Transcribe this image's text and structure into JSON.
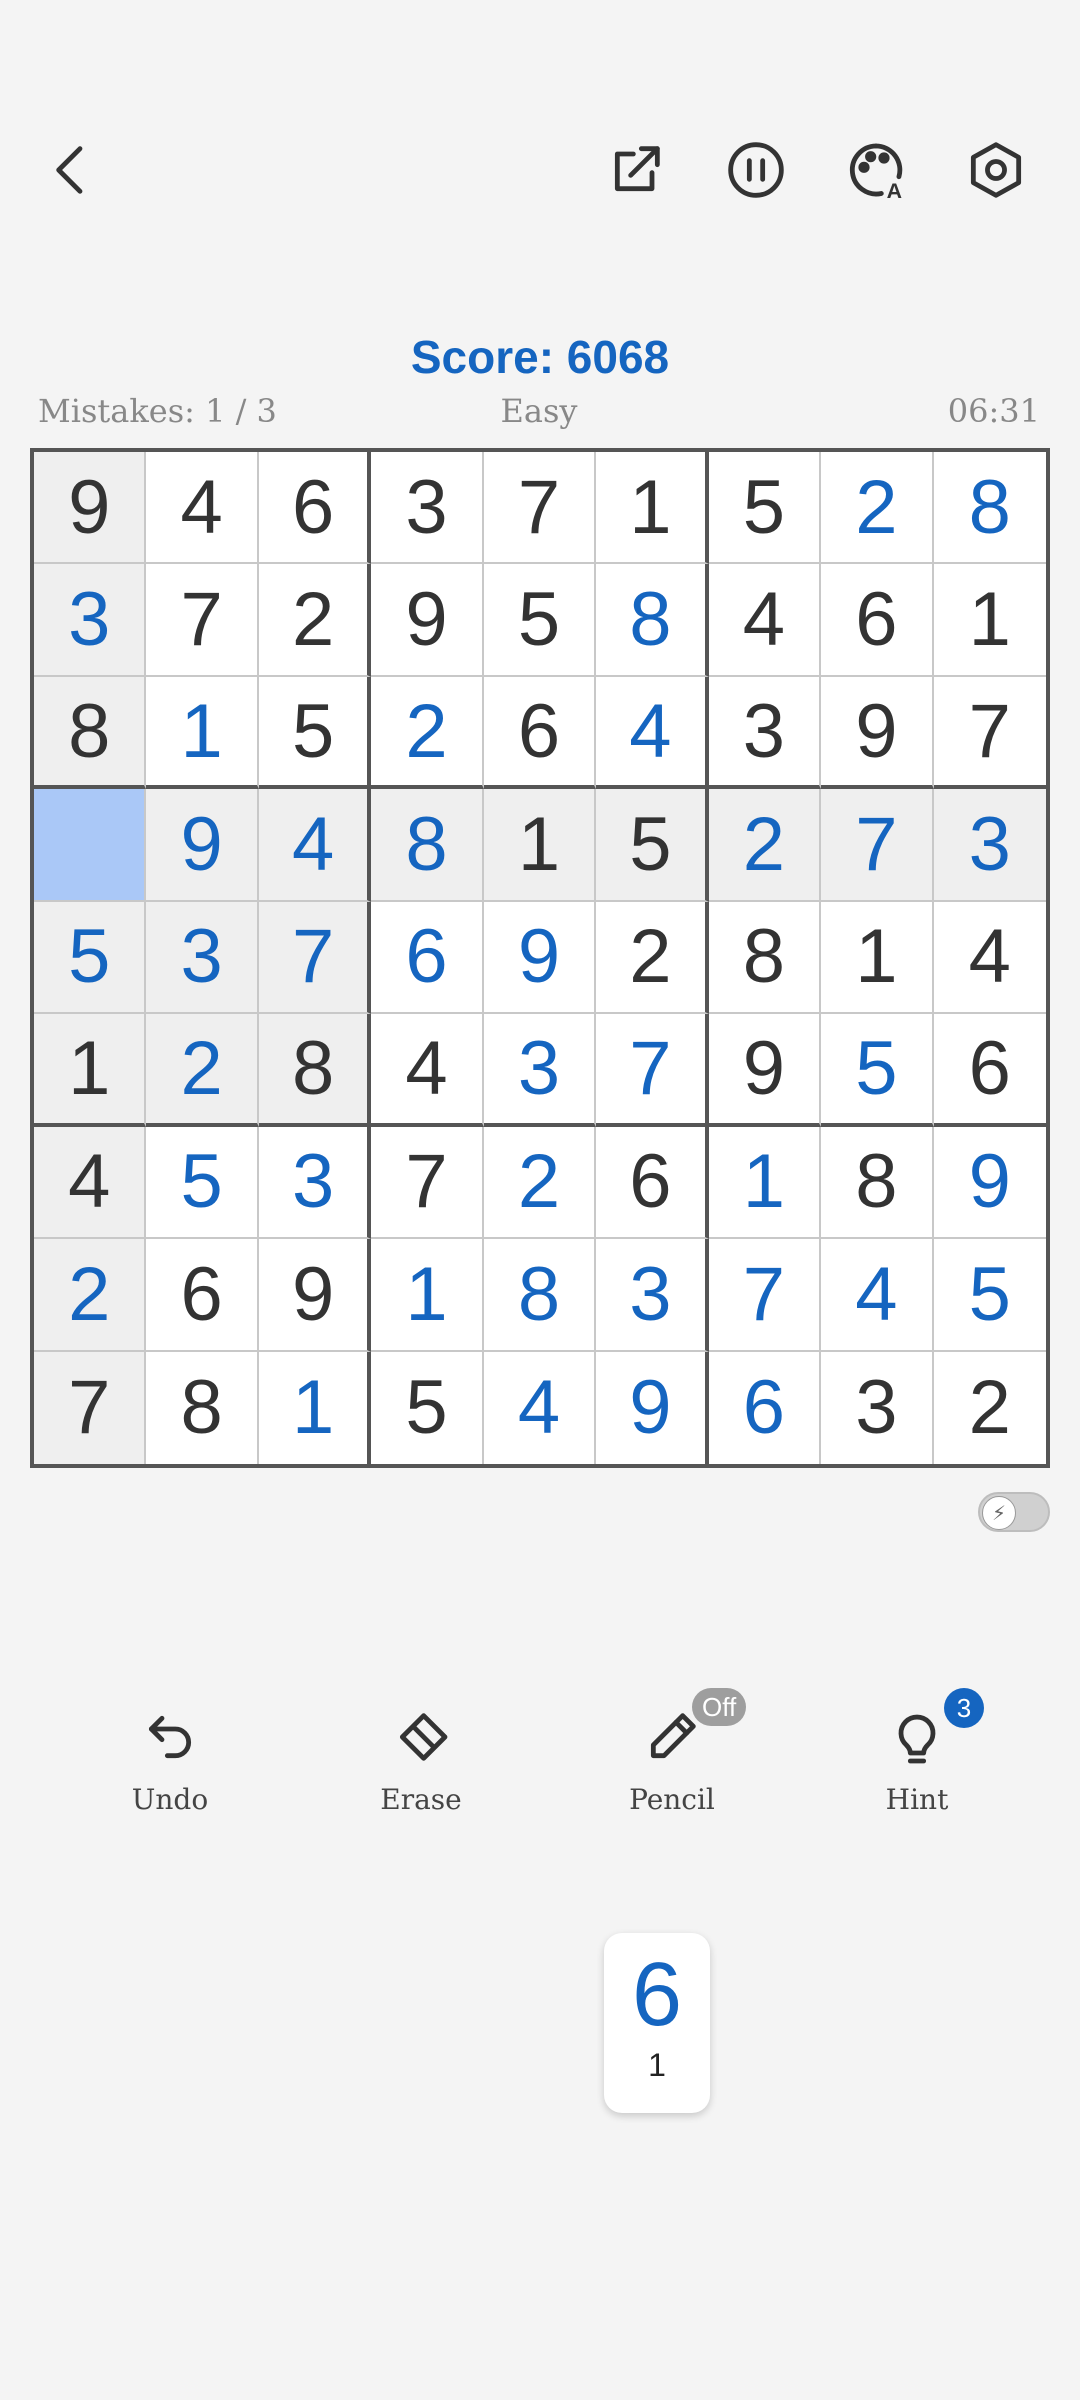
{
  "header": {
    "score_label": "Score: 6068",
    "mistakes": "Mistakes: 1 / 3",
    "difficulty": "Easy",
    "timer": "06:31"
  },
  "icons": {
    "back": "chevron-left-icon",
    "share": "external-link-icon",
    "pause": "pause-circle-icon",
    "theme": "palette-icon",
    "settings": "hexagon-gear-icon"
  },
  "board": {
    "selected": [
      3,
      0
    ],
    "highlighted_row": 3,
    "highlighted_col": 0,
    "cells": [
      [
        {
          "v": "9",
          "t": "given"
        },
        {
          "v": "4",
          "t": "given"
        },
        {
          "v": "6",
          "t": "given"
        },
        {
          "v": "3",
          "t": "given"
        },
        {
          "v": "7",
          "t": "given"
        },
        {
          "v": "1",
          "t": "given"
        },
        {
          "v": "5",
          "t": "given"
        },
        {
          "v": "2",
          "t": "user"
        },
        {
          "v": "8",
          "t": "user"
        }
      ],
      [
        {
          "v": "3",
          "t": "user"
        },
        {
          "v": "7",
          "t": "given"
        },
        {
          "v": "2",
          "t": "given"
        },
        {
          "v": "9",
          "t": "given"
        },
        {
          "v": "5",
          "t": "given"
        },
        {
          "v": "8",
          "t": "user"
        },
        {
          "v": "4",
          "t": "given"
        },
        {
          "v": "6",
          "t": "given"
        },
        {
          "v": "1",
          "t": "given"
        }
      ],
      [
        {
          "v": "8",
          "t": "given"
        },
        {
          "v": "1",
          "t": "user"
        },
        {
          "v": "5",
          "t": "given"
        },
        {
          "v": "2",
          "t": "user"
        },
        {
          "v": "6",
          "t": "given"
        },
        {
          "v": "4",
          "t": "user"
        },
        {
          "v": "3",
          "t": "given"
        },
        {
          "v": "9",
          "t": "given"
        },
        {
          "v": "7",
          "t": "given"
        }
      ],
      [
        {
          "v": "",
          "t": "empty"
        },
        {
          "v": "9",
          "t": "user"
        },
        {
          "v": "4",
          "t": "user"
        },
        {
          "v": "8",
          "t": "user"
        },
        {
          "v": "1",
          "t": "given"
        },
        {
          "v": "5",
          "t": "given"
        },
        {
          "v": "2",
          "t": "user"
        },
        {
          "v": "7",
          "t": "user"
        },
        {
          "v": "3",
          "t": "user"
        }
      ],
      [
        {
          "v": "5",
          "t": "user"
        },
        {
          "v": "3",
          "t": "user"
        },
        {
          "v": "7",
          "t": "user"
        },
        {
          "v": "6",
          "t": "user"
        },
        {
          "v": "9",
          "t": "user"
        },
        {
          "v": "2",
          "t": "given"
        },
        {
          "v": "8",
          "t": "given"
        },
        {
          "v": "1",
          "t": "given"
        },
        {
          "v": "4",
          "t": "given"
        }
      ],
      [
        {
          "v": "1",
          "t": "given"
        },
        {
          "v": "2",
          "t": "user"
        },
        {
          "v": "8",
          "t": "given"
        },
        {
          "v": "4",
          "t": "given"
        },
        {
          "v": "3",
          "t": "user"
        },
        {
          "v": "7",
          "t": "user"
        },
        {
          "v": "9",
          "t": "given"
        },
        {
          "v": "5",
          "t": "user"
        },
        {
          "v": "6",
          "t": "given"
        }
      ],
      [
        {
          "v": "4",
          "t": "given"
        },
        {
          "v": "5",
          "t": "user"
        },
        {
          "v": "3",
          "t": "user"
        },
        {
          "v": "7",
          "t": "given"
        },
        {
          "v": "2",
          "t": "user"
        },
        {
          "v": "6",
          "t": "given"
        },
        {
          "v": "1",
          "t": "user"
        },
        {
          "v": "8",
          "t": "given"
        },
        {
          "v": "9",
          "t": "user"
        }
      ],
      [
        {
          "v": "2",
          "t": "user"
        },
        {
          "v": "6",
          "t": "given"
        },
        {
          "v": "9",
          "t": "given"
        },
        {
          "v": "1",
          "t": "user"
        },
        {
          "v": "8",
          "t": "user"
        },
        {
          "v": "3",
          "t": "user"
        },
        {
          "v": "7",
          "t": "user"
        },
        {
          "v": "4",
          "t": "user"
        },
        {
          "v": "5",
          "t": "user"
        }
      ],
      [
        {
          "v": "7",
          "t": "given"
        },
        {
          "v": "8",
          "t": "given"
        },
        {
          "v": "1",
          "t": "user"
        },
        {
          "v": "5",
          "t": "given"
        },
        {
          "v": "4",
          "t": "user"
        },
        {
          "v": "9",
          "t": "user"
        },
        {
          "v": "6",
          "t": "user"
        },
        {
          "v": "3",
          "t": "given"
        },
        {
          "v": "2",
          "t": "given"
        }
      ]
    ]
  },
  "toolbar": {
    "undo": "Undo",
    "erase": "Erase",
    "pencil": "Pencil",
    "pencil_state": "Off",
    "hint": "Hint",
    "hint_count": "3"
  },
  "numpad": {
    "digit": "6",
    "remaining": "1"
  },
  "colors": {
    "accent": "#1565c0",
    "selected_cell": "#aac8f7",
    "highlight_cell": "#efefef"
  }
}
